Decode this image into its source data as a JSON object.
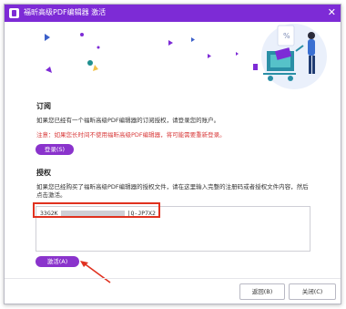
{
  "window": {
    "title": "福昕高级PDF编辑器 激活",
    "close_glyph": "✕"
  },
  "subscribe": {
    "heading": "订阅",
    "desc": "如果您已经有一个福昕高级PDF编辑器的订阅授权，请登录您的账户。",
    "note": "注意：如果您长时间不使用福昕高级PDF编辑器，将可能需要重新登录。",
    "login_button": "登录(S)"
  },
  "license": {
    "heading": "授权",
    "desc": "如果您已经购买了福昕高级PDF编辑器的授权文件，请在这里输入完整的注册码或者授权文件内容，然后点击激活。",
    "code_prefix": "33G2K",
    "code_suffix": "|Q-JP7X2",
    "activate_button": "激活(A)"
  },
  "footer": {
    "back_button": "返回(B)",
    "close_button": "关闭(C)"
  },
  "colors": {
    "titlebar": "#7d2bd6",
    "accent_purple": "#8a33cc",
    "annotation_red": "#e0311f",
    "note_red": "#d83a3a"
  }
}
